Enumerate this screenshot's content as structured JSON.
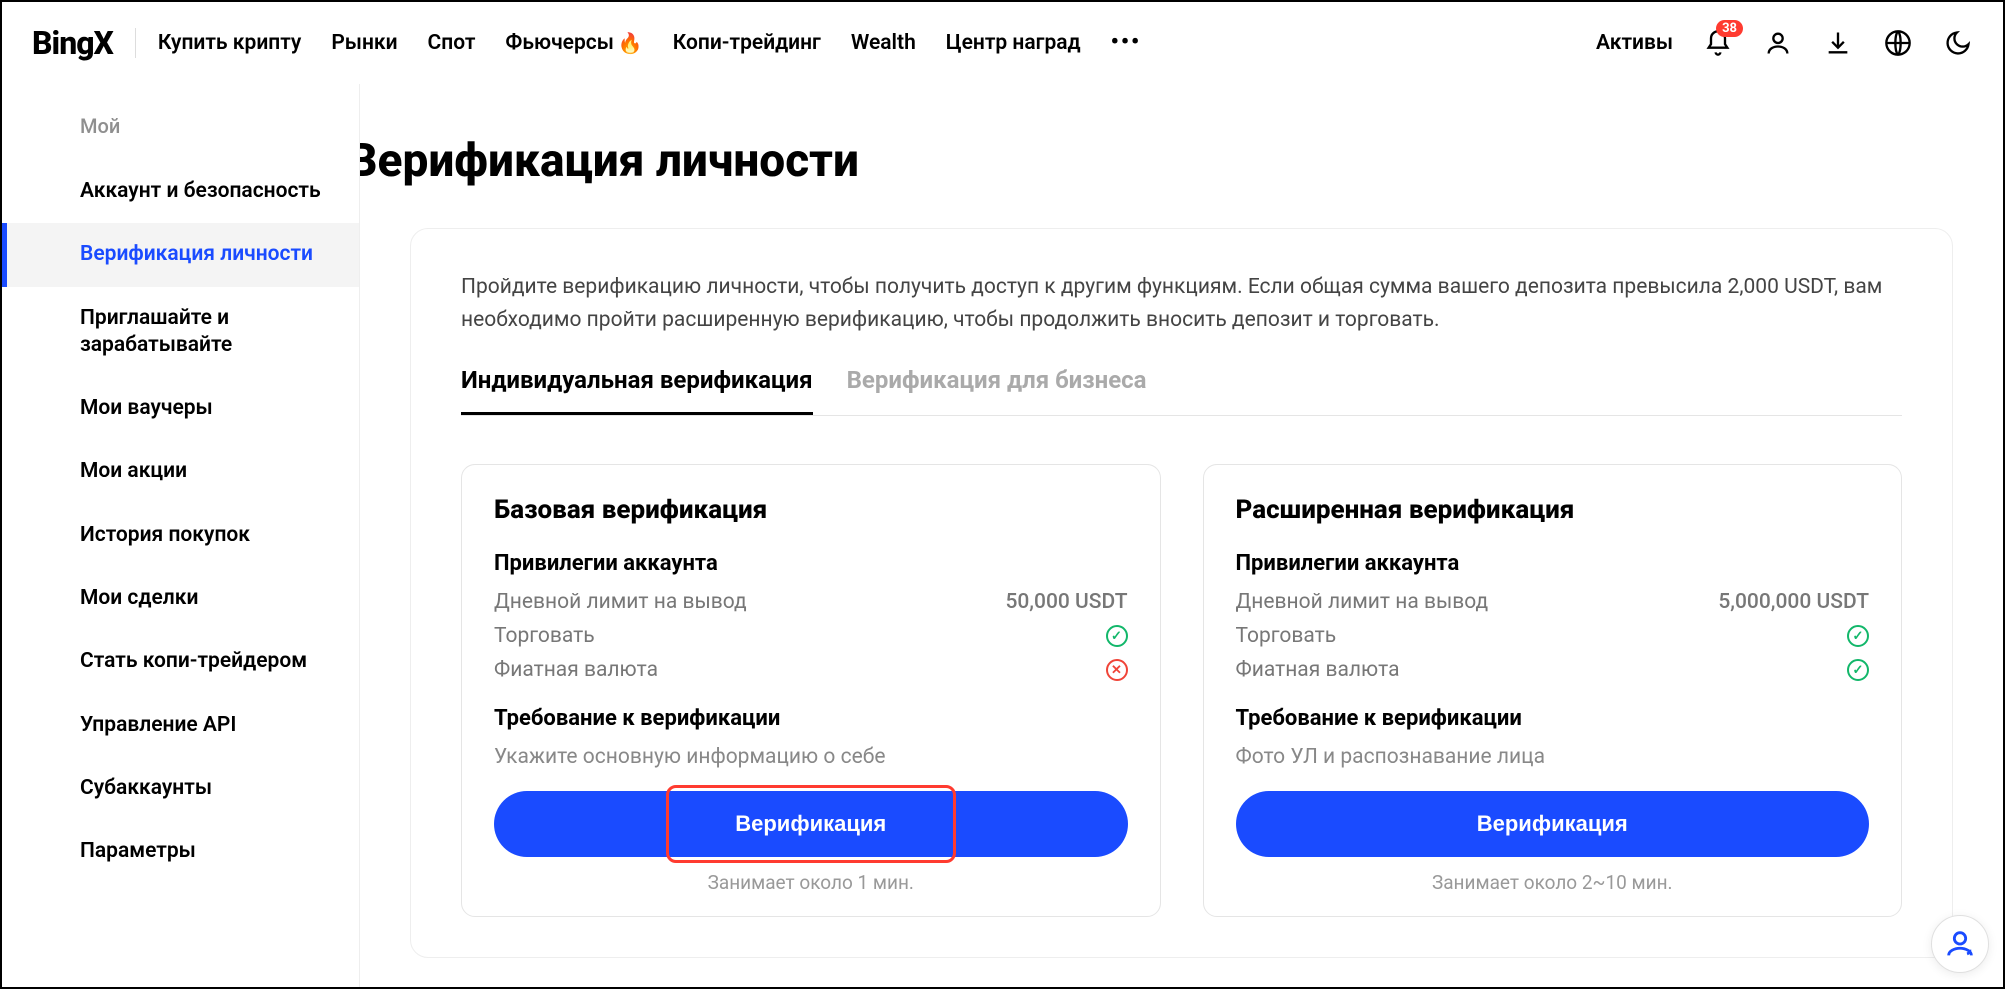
{
  "brand": "BingX",
  "nav": {
    "links": [
      "Купить крипту",
      "Рынки",
      "Спот",
      "Фьючерсы",
      "Копи-трейдинг",
      "Wealth",
      "Центр наград"
    ],
    "assets": "Активы",
    "notif_badge": "38"
  },
  "sidebar": {
    "header": "Мой",
    "items": [
      "Аккаунт и безопасность",
      "Верификация личности",
      "Приглашайте и зарабатывайте",
      "Мои ваучеры",
      "Мои акции",
      "История покупок",
      "Мои сделки",
      "Стать копи-трейдером",
      "Управление API",
      "Субаккаунты",
      "Параметры"
    ],
    "active_index": 1
  },
  "page": {
    "title": "Верификация личности",
    "intro": "Пройдите верификацию личности, чтобы получить доступ к другим функциям. Если общая сумма вашего депозита превысила 2,000 USDT, вам необходимо пройти расширенную верификацию, чтобы продолжить вносить депозит и торговать."
  },
  "tabs": {
    "individual": "Индивидуальная верификация",
    "business": "Верификация для бизнеса"
  },
  "privileges_heading": "Привилегии аккаунта",
  "rows": {
    "withdrawal": "Дневной лимит на вывод",
    "trade": "Торговать",
    "fiat": "Фиатная валюта"
  },
  "req_heading": "Требование к верификации",
  "card_basic": {
    "title": "Базовая верификация",
    "withdraw_limit": "50,000 USDT",
    "trade_ok": true,
    "fiat_ok": false,
    "req_desc": "Укажите основную информацию о себе",
    "cta": "Верификация",
    "note": "Занимает около 1 мин."
  },
  "card_adv": {
    "title": "Расширенная верификация",
    "withdraw_limit": "5,000,000 USDT",
    "trade_ok": true,
    "fiat_ok": true,
    "req_desc": "Фото УЛ и распознавание лица",
    "cta": "Верификация",
    "note": "Занимает около 2~10 мин."
  }
}
